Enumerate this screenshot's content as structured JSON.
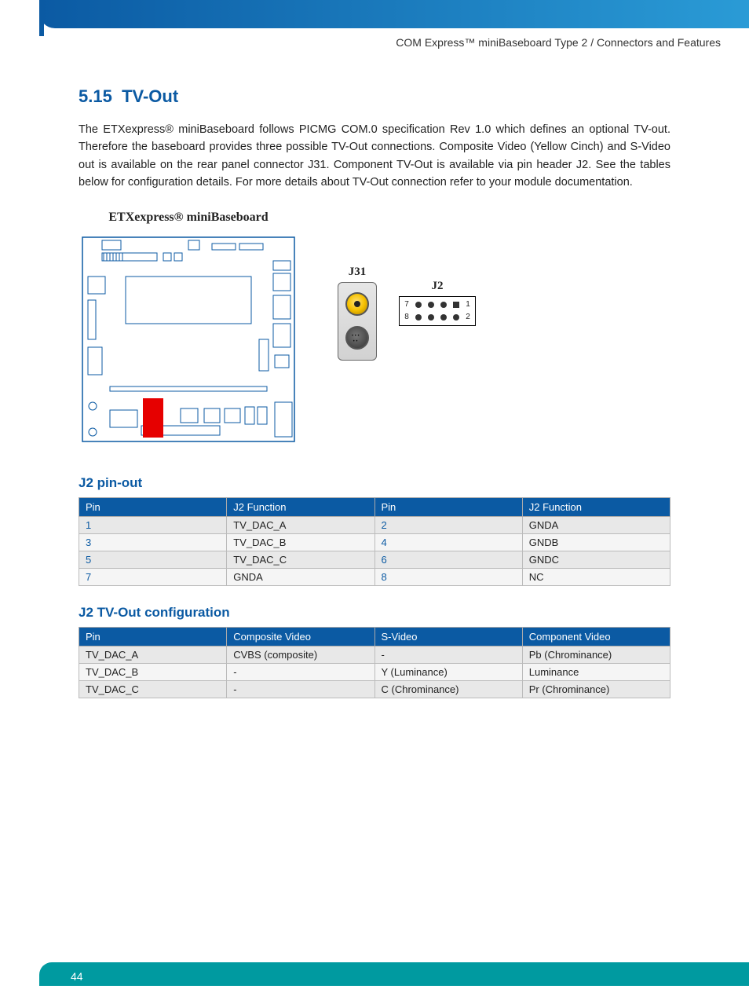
{
  "breadcrumb": "COM Express™ miniBaseboard Type 2 / Connectors and Features",
  "section_number": "5.15",
  "section_title": "TV-Out",
  "paragraph": "The ETXexpress® miniBaseboard follows PICMG COM.0 specification Rev 1.0 which defines an optional TV-out. Therefore the baseboard provides three possible TV-Out connections. Composite Video (Yellow Cinch) and S-Video out is available on the rear panel connector J31. Component TV-Out is available via pin header J2. See the tables below for configuration details. For more details about TV-Out connection refer to your module documentation.",
  "board_title": "ETXexpress® miniBaseboard",
  "j31_label": "J31",
  "j2_label": "J2",
  "j2_pin_nums": {
    "tl": "7",
    "tr": "1",
    "bl": "8",
    "br": "2"
  },
  "j2_pinout_heading": "J2 pin-out",
  "j2_pinout_headers": [
    "Pin",
    "J2 Function",
    "Pin",
    "J2 Function"
  ],
  "j2_pinout_rows": [
    {
      "p1": "1",
      "f1": "TV_DAC_A",
      "p2": "2",
      "f2": "GNDA"
    },
    {
      "p1": "3",
      "f1": "TV_DAC_B",
      "p2": "4",
      "f2": "GNDB"
    },
    {
      "p1": "5",
      "f1": "TV_DAC_C",
      "p2": "6",
      "f2": "GNDC"
    },
    {
      "p1": "7",
      "f1": "GNDA",
      "p2": "8",
      "f2": "NC"
    }
  ],
  "j2_config_heading": "J2 TV-Out configuration",
  "j2_config_headers": [
    "Pin",
    "Composite Video",
    "S-Video",
    "Component Video"
  ],
  "j2_config_rows": [
    {
      "pin": "TV_DAC_A",
      "comp": "CVBS (composite)",
      "sv": "-",
      "cv": "Pb (Chrominance)"
    },
    {
      "pin": "TV_DAC_B",
      "comp": "-",
      "sv": "Y (Luminance)",
      "cv": "Luminance"
    },
    {
      "pin": "TV_DAC_C",
      "comp": "-",
      "sv": "C (Chrominance)",
      "cv": "Pr (Chrominance)"
    }
  ],
  "page_number": "44"
}
